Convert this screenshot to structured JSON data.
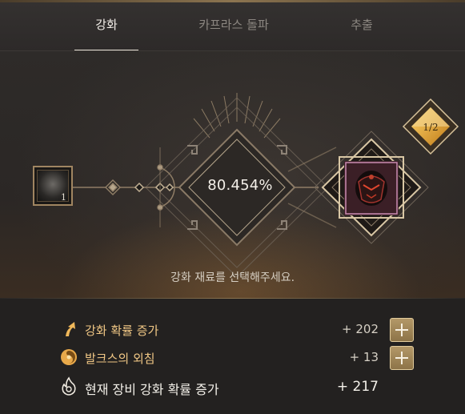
{
  "tabs": [
    {
      "label": "강화",
      "active": true
    },
    {
      "label": "카프라스 돌파",
      "active": false
    },
    {
      "label": "추출",
      "active": false
    }
  ],
  "enhance": {
    "material_count": "1",
    "success_rate": "80.454%",
    "equipment_badge": "1/2",
    "hint": "강화 재료를 선택해주세요."
  },
  "stats": [
    {
      "label": "강화 확률 증가",
      "value": "+ 202",
      "icon": "arrow-up-icon"
    },
    {
      "label": "발크스의 외침",
      "value": "+ 13",
      "icon": "valks-cry-icon"
    },
    {
      "label": "현재 장비 강화 확률 증가",
      "value": "+ 217",
      "icon": "flame-icon"
    }
  ],
  "colors": {
    "accent_gold": "#f0c785",
    "badge_gold": "#e8b23c",
    "frame": "#a08561"
  }
}
